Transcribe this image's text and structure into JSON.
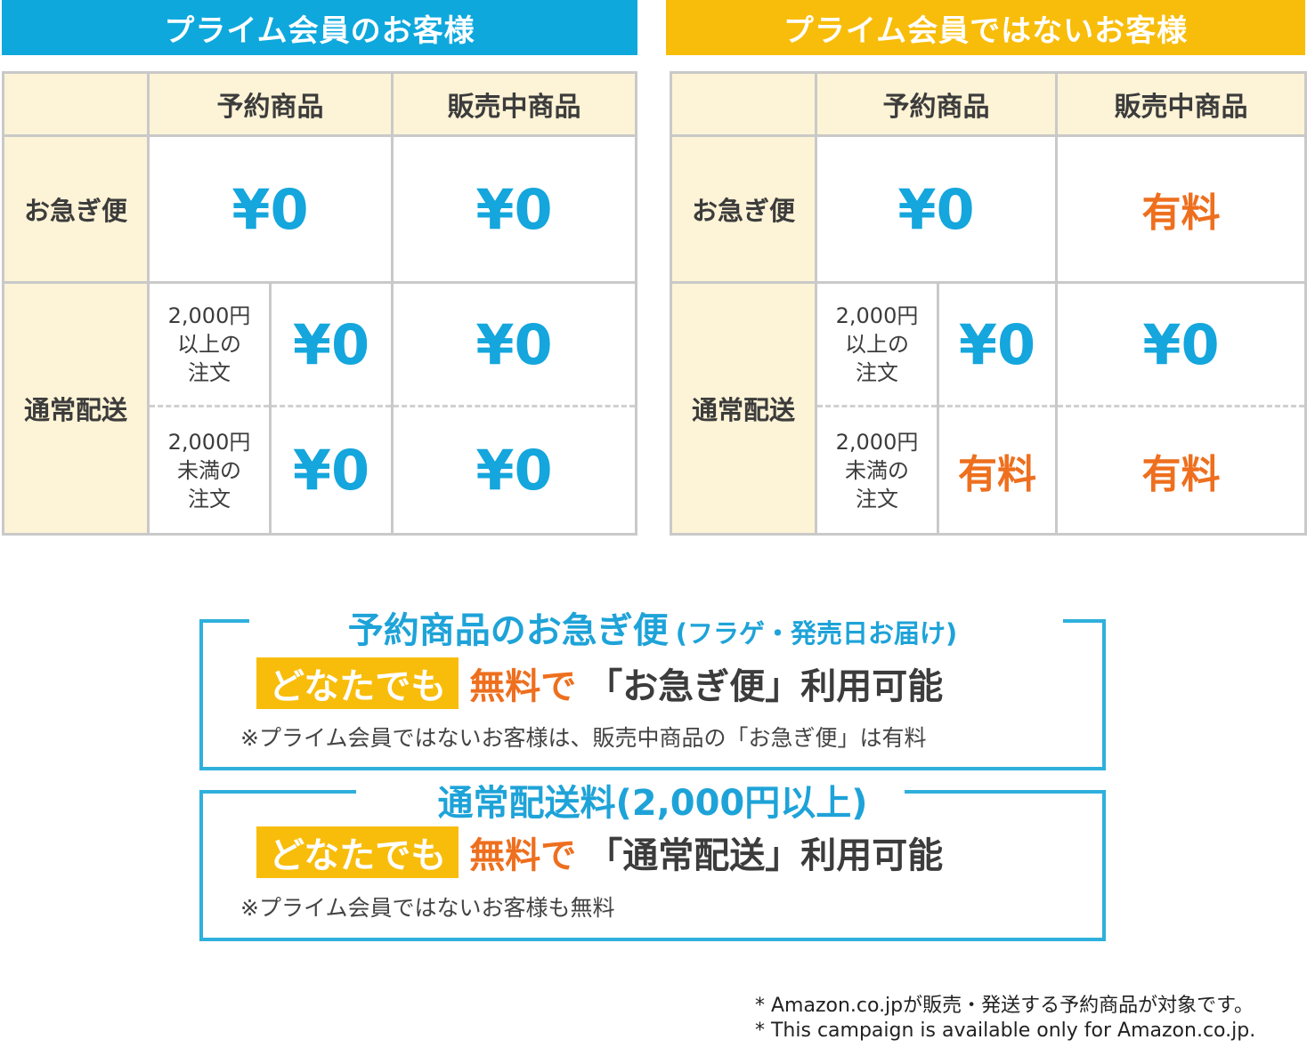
{
  "headers": {
    "prime": "プライム会員のお客様",
    "non_prime": "プライム会員ではないお客様"
  },
  "tables": {
    "prime": {
      "col_preorder": "予約商品",
      "col_onsale": "販売中商品",
      "row_express": "お急ぎ便",
      "row_standard": "通常配送",
      "cond_over": "2,000円\n以上の\n注文",
      "cond_under": "2,000円\n未満の\n注文",
      "express_preorder": "¥0",
      "express_onsale": "¥0",
      "standard_over_preorder": "¥0",
      "standard_over_onsale": "¥0",
      "standard_under_preorder": "¥0",
      "standard_under_onsale": "¥0"
    },
    "non_prime": {
      "col_preorder": "予約商品",
      "col_onsale": "販売中商品",
      "row_express": "お急ぎ便",
      "row_standard": "通常配送",
      "cond_over": "2,000円\n以上の\n注文",
      "cond_under": "2,000円\n未満の\n注文",
      "express_preorder": "¥0",
      "express_onsale": "有料",
      "standard_over_preorder": "¥0",
      "standard_over_onsale": "¥0",
      "standard_under_preorder": "有料",
      "standard_under_onsale": "有料"
    }
  },
  "box_express": {
    "title": "予約商品のお急ぎ便",
    "title_sub": "(フラゲ・発売日お届け)",
    "badge": "どなたでも",
    "free": "無料で",
    "service": "「お急ぎ便」利用可能",
    "note": "※プライム会員ではないお客様は、販売中商品の「お急ぎ便」は有料"
  },
  "box_standard": {
    "title": "通常配送料(2,000円以上)",
    "badge": "どなたでも",
    "free": "無料で",
    "service": "「通常配送」利用可能",
    "note": "※プライム会員ではないお客様も無料"
  },
  "footnotes": [
    "* Amazon.co.jpが販売・発送する予約商品が対象です。",
    "* This campaign is available only for Amazon.co.jp."
  ],
  "colors": {
    "prime_blue": "#0ea8dd",
    "non_prime_yellow": "#f8bd0b",
    "free_value_blue": "#14a6dc",
    "paid_orange": "#ee6f1e",
    "header_cream": "#fdf3d6"
  }
}
